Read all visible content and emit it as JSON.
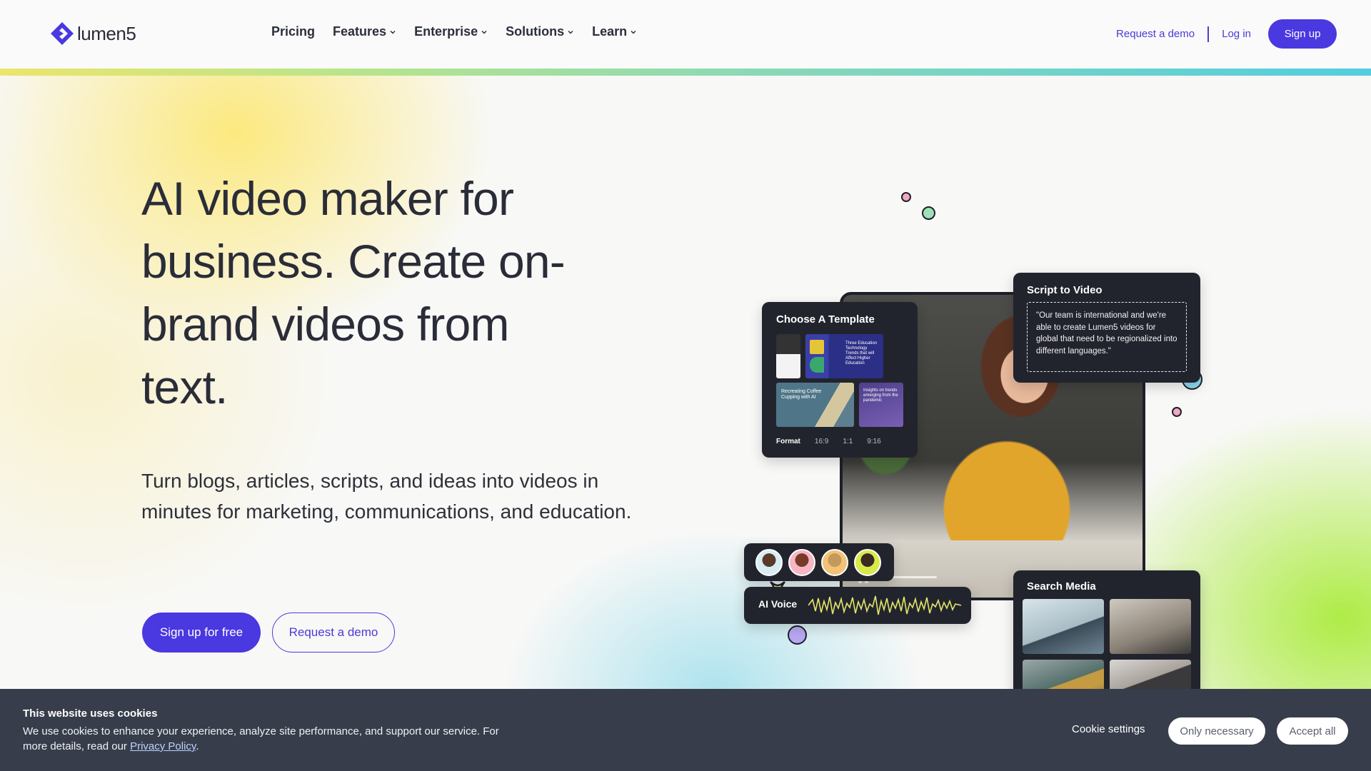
{
  "brand": {
    "name": "lumen5",
    "accent": "#4a38e0"
  },
  "nav": {
    "links": [
      {
        "label": "Pricing",
        "has_dropdown": false
      },
      {
        "label": "Features",
        "has_dropdown": true
      },
      {
        "label": "Enterprise",
        "has_dropdown": true
      },
      {
        "label": "Solutions",
        "has_dropdown": true
      },
      {
        "label": "Learn",
        "has_dropdown": true
      }
    ],
    "request_demo": "Request a demo",
    "login": "Log in",
    "signup": "Sign up"
  },
  "hero": {
    "headline": "AI video maker for business. Create on-brand videos from text.",
    "subline": "Turn blogs, articles, scripts, and ideas into videos in minutes for marketing, communications, and education.",
    "cta_primary": "Sign up for free",
    "cta_secondary": "Request a demo"
  },
  "collage": {
    "template_card": {
      "title": "Choose A Template",
      "thumb_texts": {
        "t2": "Three Education Technology Trends that will Affect Higher Education",
        "t3": "Recreating Coffee Cupping with AI",
        "t4": "Insights on trends emerging from the pandemic"
      },
      "format_label": "Format",
      "formats": [
        "16:9",
        "1:1",
        "9:16"
      ]
    },
    "script_card": {
      "title": "Script to Video",
      "quote": "\"Our team is international and we're able to create Lumen5 videos for global that need to be regionalized into different languages.\""
    },
    "voice_card": {
      "title": "AI Voice"
    },
    "media_card": {
      "title": "Search Media"
    }
  },
  "cookie": {
    "title": "This website uses cookies",
    "text": "We use cookies to enhance your experience, analyze site performance, and support our service. For more details, read our ",
    "link": "Privacy Policy",
    "text_end": ".",
    "settings": "Cookie settings",
    "only_necessary": "Only necessary",
    "accept_all": "Accept all"
  }
}
